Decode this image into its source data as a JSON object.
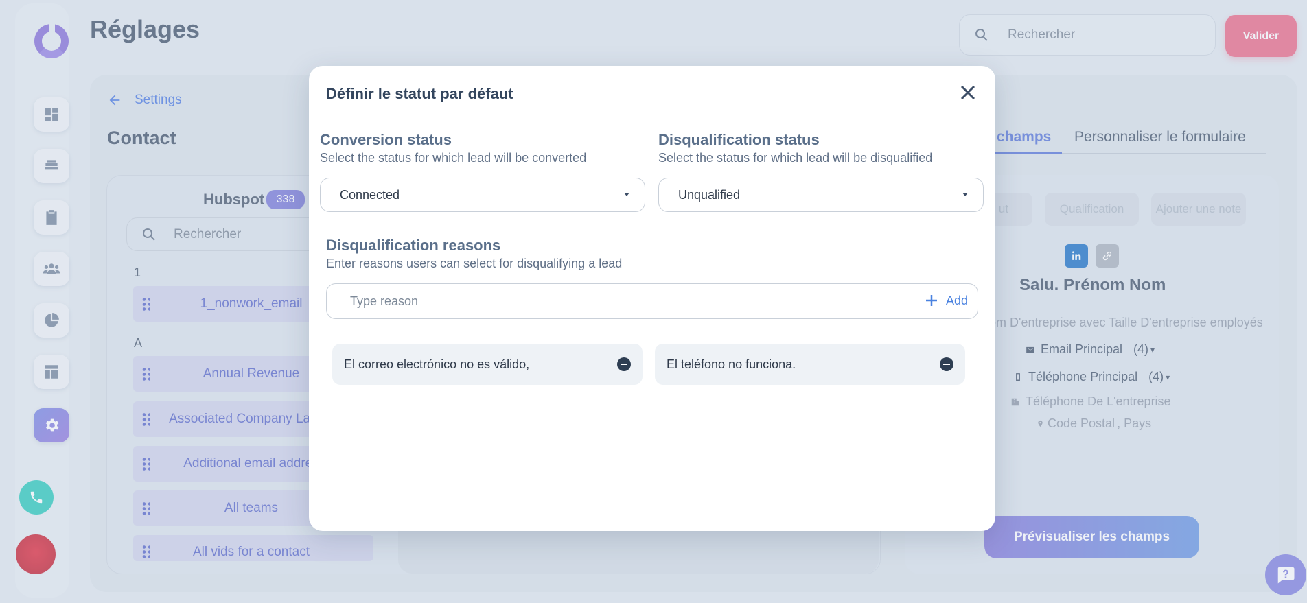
{
  "app": {
    "page_title": "Réglages",
    "search_placeholder": "Rechercher",
    "validate_label": "Valider"
  },
  "sidebar": {
    "items": [
      {
        "icon": "dashboard-icon"
      },
      {
        "icon": "layers-icon"
      },
      {
        "icon": "clipboard-icon"
      },
      {
        "icon": "users-icon"
      },
      {
        "icon": "pie-chart-icon"
      },
      {
        "icon": "layout-icon"
      },
      {
        "icon": "gear-icon",
        "active": true
      }
    ],
    "phone_icon": "phone-icon"
  },
  "breadcrumb": {
    "back_label": "Settings"
  },
  "section": {
    "title": "Contact"
  },
  "fields_panel": {
    "source": "Hubspot",
    "count": "338",
    "search_placeholder": "Rechercher",
    "groups": [
      {
        "letter": "1",
        "items": [
          "1_nonwork_email"
        ]
      },
      {
        "letter": "A",
        "items": [
          "Annual Revenue",
          "Associated Company Last U",
          "Additional email addres",
          "All teams",
          "All vids for a contact"
        ]
      }
    ]
  },
  "right_panel": {
    "tab_active": "champs",
    "tab_other": "Personnaliser le formulaire",
    "chips": [
      "ut",
      "Qualification",
      "Ajouter une note"
    ],
    "contact_name": "Salu. Prénom Nom",
    "company_line": "om D'entreprise avec Taille D'entreprise employés",
    "email_label": "Email Principal",
    "email_count": "(4)",
    "phone_label": "Téléphone Principal",
    "phone_count": "(4)",
    "company_phone": "Téléphone De L'entreprise",
    "postal": "Code Postal",
    "country": "Pays",
    "preview_button": "Prévisualiser les champs"
  },
  "modal": {
    "title": "Définir le statut par défaut",
    "conversion": {
      "label": "Conversion status",
      "help": "Select the status for which lead will be converted",
      "value": "Connected"
    },
    "disqualification": {
      "label": "Disqualification status",
      "help": "Select the status for which lead will be disqualified",
      "value": "Unqualified"
    },
    "reasons": {
      "label": "Disqualification reasons",
      "help": "Enter reasons users can select for disqualifying a lead",
      "placeholder": "Type reason",
      "add_label": "Add",
      "items": [
        "El correo electrónico no es válido,",
        "El teléfono no funciona."
      ]
    }
  },
  "colors": {
    "accent": "#4b6bd6",
    "validate": "#ea5e7f",
    "phone": "#1cc7b7",
    "active_nav": "#7377e0"
  }
}
